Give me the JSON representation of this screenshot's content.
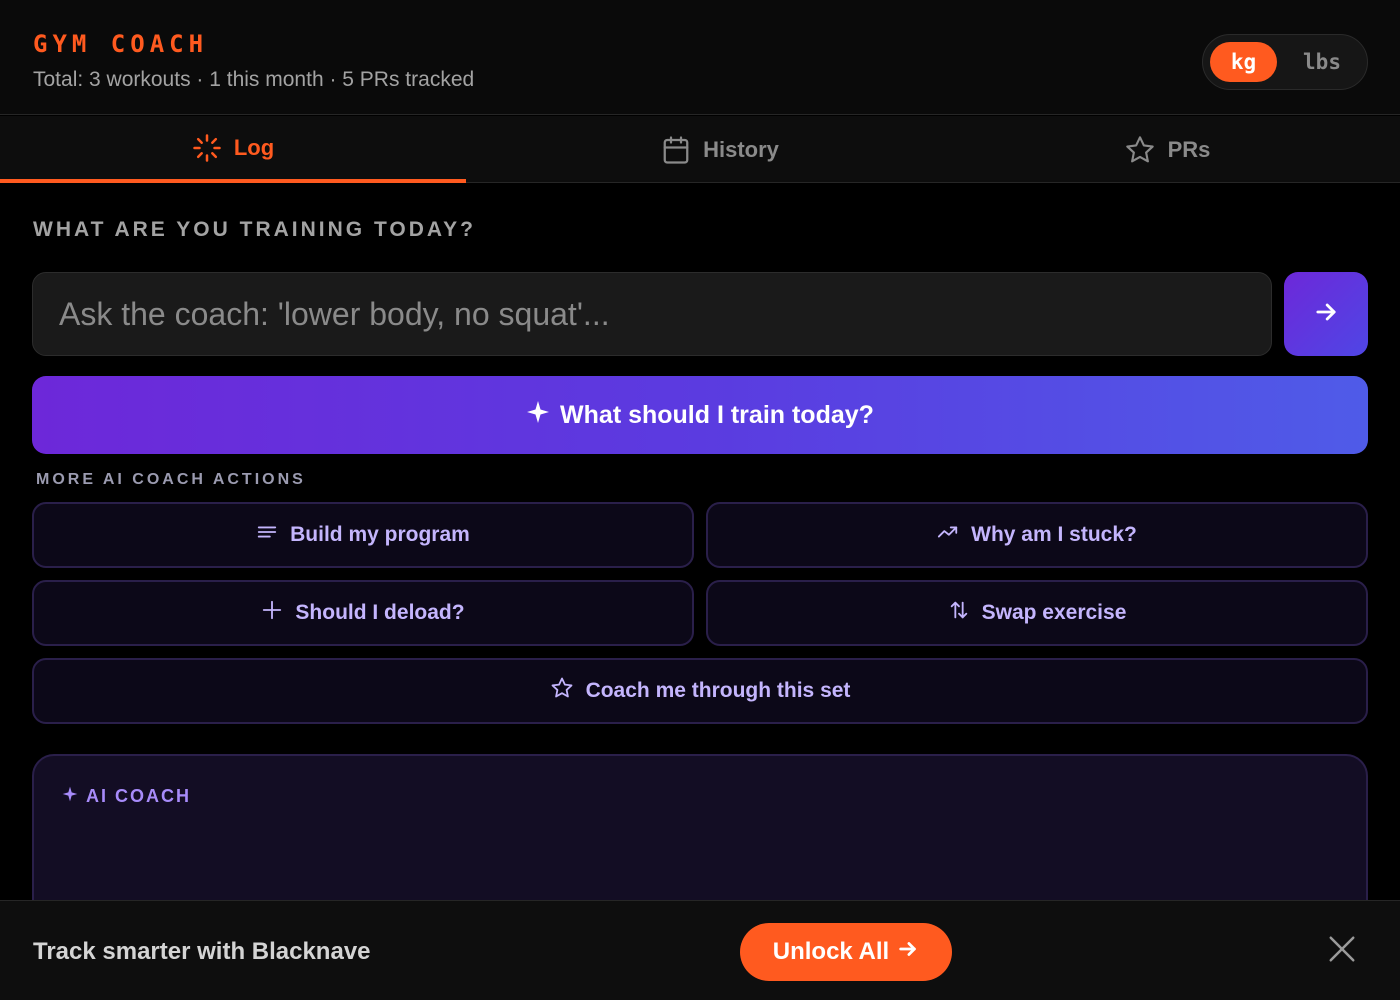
{
  "header": {
    "brand": "GYM COACH",
    "stats": "Total: 3 workouts · 1 this month · 5 PRs tracked",
    "units": {
      "kg": "kg",
      "lbs": "lbs",
      "selected": "kg"
    }
  },
  "tabs": [
    {
      "label": "Log",
      "icon": "loader-icon",
      "active": true
    },
    {
      "label": "History",
      "icon": "calendar-icon",
      "active": false
    },
    {
      "label": "PRs",
      "icon": "star-icon",
      "active": false
    }
  ],
  "main": {
    "heading": "WHAT ARE YOU TRAINING TODAY?",
    "ask_placeholder": "Ask the coach: 'lower body, no squat'...",
    "ask_value": "",
    "train_button": "What should I train today?",
    "more_heading": "MORE AI COACH ACTIONS",
    "actions": [
      {
        "label": "Build my program",
        "icon": "list-icon"
      },
      {
        "label": "Why am I stuck?",
        "icon": "trending-icon"
      },
      {
        "label": "Should I deload?",
        "icon": "plus-icon"
      },
      {
        "label": "Swap exercise",
        "icon": "swap-icon"
      },
      {
        "label": "Coach me through this set",
        "icon": "star-icon"
      }
    ],
    "coach_panel_title": "AI COACH"
  },
  "banner": {
    "text": "Track smarter with Blacknave",
    "unlock_button": "Unlock All"
  },
  "colors": {
    "accent": "#ff5a1f",
    "purple": "#6d28d9",
    "indigo": "#4f46e5",
    "action_text": "#c4b5fd"
  }
}
